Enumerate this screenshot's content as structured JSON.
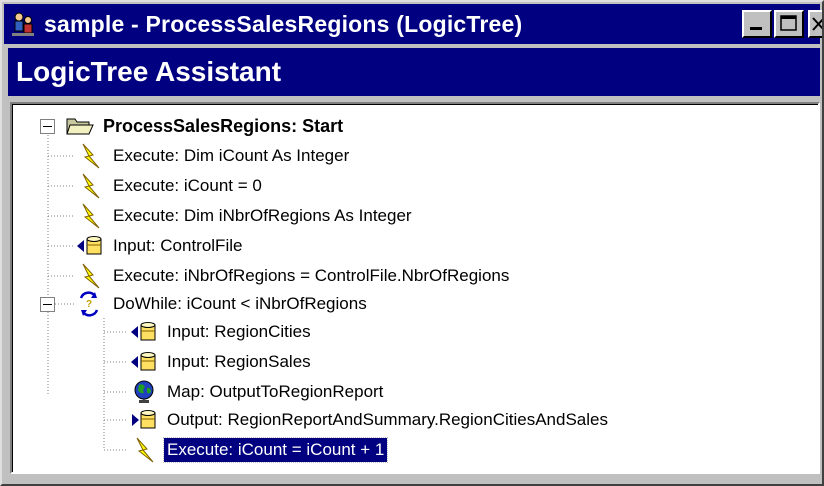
{
  "window": {
    "title": "sample - ProcessSalesRegions (LogicTree)",
    "icon": "people-icon"
  },
  "header": {
    "title": "LogicTree Assistant"
  },
  "tree": {
    "root": {
      "label": "ProcessSalesRegions: Start",
      "icon": "folder-open-icon",
      "expanded": true
    },
    "children": [
      {
        "label": "Execute: Dim iCount As Integer",
        "icon": "lightning-icon"
      },
      {
        "label": "Execute: iCount = 0",
        "icon": "lightning-icon"
      },
      {
        "label": "Execute: Dim iNbrOfRegions As Integer",
        "icon": "lightning-icon"
      },
      {
        "label": "Input: ControlFile",
        "icon": "database-input-icon"
      },
      {
        "label": "Execute: iNbrOfRegions = ControlFile.NbrOfRegions",
        "icon": "lightning-icon"
      },
      {
        "label": "DoWhile: iCount < iNbrOfRegions",
        "icon": "loop-icon",
        "expanded": true
      }
    ],
    "loop_children": [
      {
        "label": "Input: RegionCities",
        "icon": "database-input-icon"
      },
      {
        "label": "Input: RegionSales",
        "icon": "database-input-icon"
      },
      {
        "label": "Map: OutputToRegionReport",
        "icon": "globe-icon"
      },
      {
        "label": "Output: RegionReportAndSummary.RegionCitiesAndSales",
        "icon": "database-output-icon"
      },
      {
        "label": "Execute: iCount = iCount + 1",
        "icon": "lightning-icon",
        "selected": true
      }
    ]
  },
  "colors": {
    "titlebar": "#000080",
    "selection": "#000080",
    "window_face": "#c0c0c0"
  }
}
